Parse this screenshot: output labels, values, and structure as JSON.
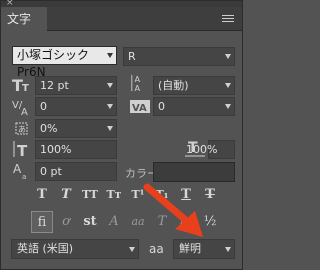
{
  "panel": {
    "close_glyph": "×",
    "tab_label": "文字",
    "menu_icon": "panel-menu-icon"
  },
  "font": {
    "family_value": "小塚ゴシック Pr6N",
    "style_value": "R"
  },
  "size": {
    "font_size_value": "12 pt",
    "leading_value": "(自動)"
  },
  "spacing": {
    "kerning_value": "0",
    "tracking_value": "0"
  },
  "tsume": {
    "value": "0%"
  },
  "scale": {
    "vertical_value": "100%",
    "horizontal_value": "100%"
  },
  "baseline": {
    "value": "0 pt",
    "color_label": "カラー："
  },
  "style_buttons": [
    "T",
    "T",
    "TT",
    "Tт",
    "T¹",
    "T₁",
    "T",
    "T"
  ],
  "opentype_buttons": [
    "fi",
    "ơ",
    "st",
    "A",
    "aa",
    "T",
    "1st",
    "½"
  ],
  "bottom": {
    "language_value": "英語 (米国)",
    "aa_icon": "aa",
    "antialias_value": "鮮明"
  },
  "colors": {
    "panel_bg": "#535353",
    "arrow": "#e8401c"
  }
}
